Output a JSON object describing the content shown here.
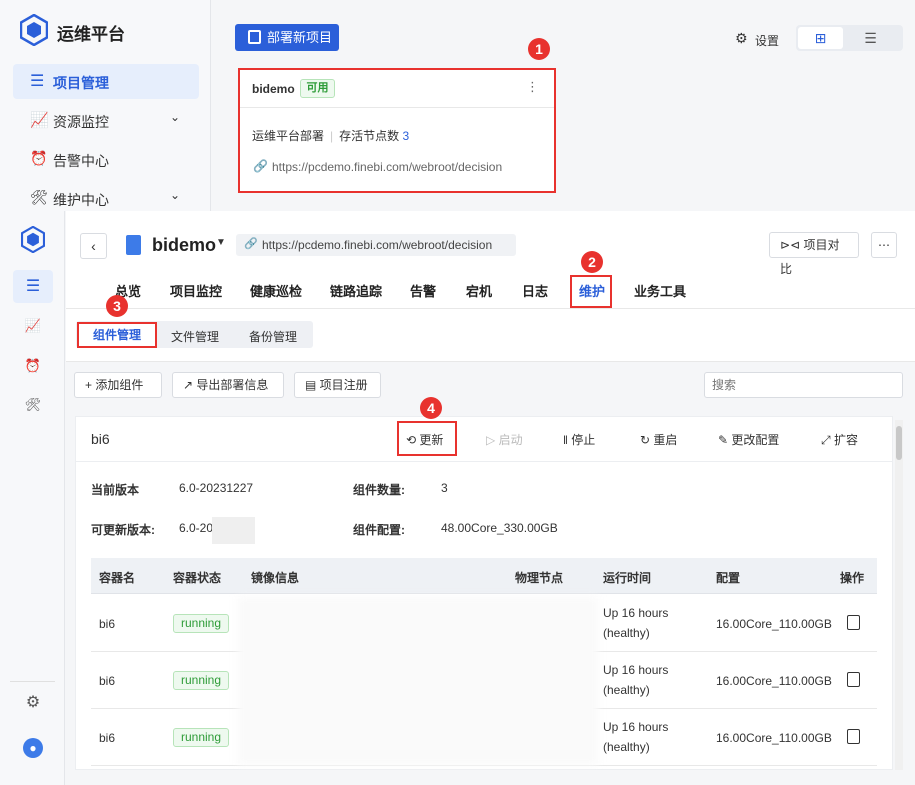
{
  "top": {
    "app_title": "运维平台",
    "nav": [
      {
        "label": "项目管理",
        "icon": "project-icon"
      },
      {
        "label": "资源监控",
        "icon": "monitor-icon"
      },
      {
        "label": "告警中心",
        "icon": "alarm-icon"
      },
      {
        "label": "维护中心",
        "icon": "maintenance-icon"
      }
    ],
    "deploy_button": "部署新项目",
    "settings": "设置",
    "card": {
      "name": "bidemo",
      "status": "可用",
      "deploy_type": "运维平台部署",
      "alive_label": "存活节点数",
      "alive_count": "3",
      "url": "https://pcdemo.finebi.com/webroot/decision"
    }
  },
  "steps": [
    "1",
    "2",
    "3",
    "4"
  ],
  "project": {
    "name": "bidemo",
    "url": "https://pcdemo.finebi.com/webroot/decision",
    "compare_button": "项目对比"
  },
  "tabs": [
    "总览",
    "项目监控",
    "健康巡检",
    "链路追踪",
    "告警",
    "宕机",
    "日志",
    "维护",
    "业务工具"
  ],
  "subtabs": [
    "组件管理",
    "文件管理",
    "备份管理"
  ],
  "toolbar": {
    "add": "添加组件",
    "export": "导出部署信息",
    "register": "项目注册",
    "search_placeholder": "搜索"
  },
  "component": {
    "name": "bi6",
    "actions": {
      "update": "更新",
      "start": "启动",
      "stop": "停止",
      "restart": "重启",
      "config": "更改配置",
      "scale": "扩容"
    },
    "current_version_label": "当前版本",
    "current_version": "6.0-20231227",
    "update_version_label": "可更新版本:",
    "update_version": "6.0-20",
    "count_label": "组件数量:",
    "count": "3",
    "config_label": "组件配置:",
    "config": "48.00Core_330.00GB"
  },
  "table": {
    "headers": [
      "容器名",
      "容器状态",
      "镜像信息",
      "物理节点",
      "运行时间",
      "配置",
      "操作"
    ],
    "rows": [
      {
        "name": "bi6",
        "status": "running",
        "uptime1": "Up 16 hours",
        "uptime2": "(healthy)",
        "config": "16.00Core_110.00GB"
      },
      {
        "name": "bi6",
        "status": "running",
        "uptime1": "Up 16 hours",
        "uptime2": "(healthy)",
        "config": "16.00Core_110.00GB"
      },
      {
        "name": "bi6",
        "status": "running",
        "uptime1": "Up 16 hours",
        "uptime2": "(healthy)",
        "config": "16.00Core_110.00GB"
      }
    ]
  },
  "colors": {
    "accent": "#2b5fd9",
    "marker": "#e8322e",
    "running": "#2e9c38"
  }
}
